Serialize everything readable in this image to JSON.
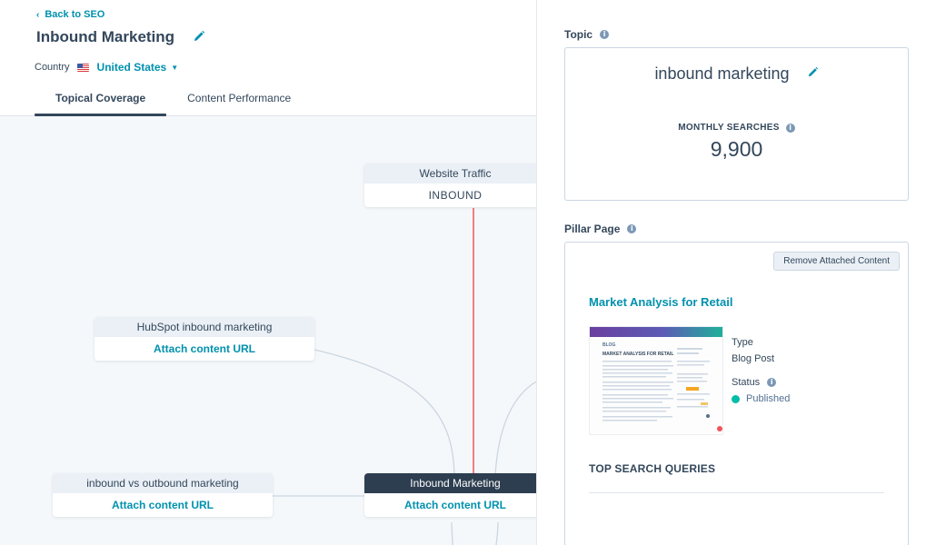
{
  "header": {
    "back_label": "Back to SEO",
    "title": "Inbound Marketing",
    "country_label": "Country",
    "country_value": "United States",
    "tabs": [
      {
        "label": "Topical Coverage",
        "active": true
      },
      {
        "label": "Content Performance",
        "active": false
      }
    ]
  },
  "canvas": {
    "nodes": {
      "top": {
        "head": "Website Traffic",
        "body": "INBOUND"
      },
      "left_upper": {
        "head": "HubSpot inbound marketing",
        "body": "Attach content URL"
      },
      "left_lower": {
        "head": "inbound vs outbound marketing",
        "body": "Attach content URL"
      },
      "center": {
        "head": "Inbound Marketing",
        "body": "Attach content URL"
      }
    }
  },
  "panel": {
    "topic_label": "Topic",
    "topic_name": "inbound marketing",
    "searches_label": "MONTHLY SEARCHES",
    "searches_value": "9,900",
    "pillar_label": "Pillar Page",
    "remove_button": "Remove Attached Content",
    "pillar_title": "Market Analysis for Retail",
    "thumb_heading": "BLOG",
    "thumb_post_title": "MARKET ANALYSIS FOR RETAIL",
    "type_label": "Type",
    "type_value": "Blog Post",
    "status_label": "Status",
    "status_value": "Published",
    "top_queries_label": "TOP SEARCH QUERIES"
  },
  "icons": {
    "title_edit": "pencil-icon",
    "topic_edit": "pencil-icon",
    "info": "info-icon",
    "flag": "us-flag-icon",
    "back": "chevron-left-icon",
    "caret": "caret-down-icon"
  },
  "colors": {
    "link": "#0091ae",
    "text": "#33475b",
    "connector_red": "#f2545b",
    "status_published": "#00bda5",
    "node_dark": "#2d3e50"
  }
}
